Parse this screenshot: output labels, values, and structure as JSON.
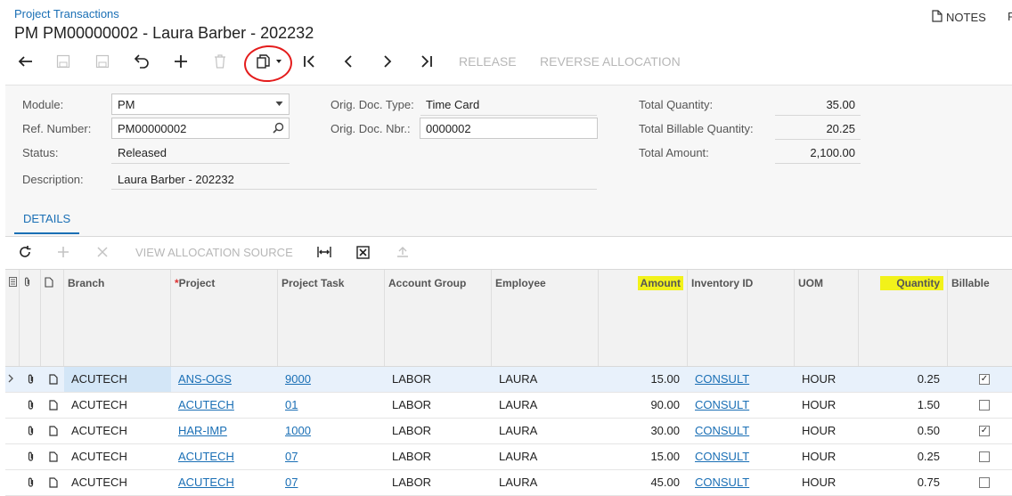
{
  "header": {
    "breadcrumb": "Project Transactions",
    "title": "PM PM00000002 - Laura Barber - 202232",
    "notes_label": "NOTES",
    "cutoff_letter": "F"
  },
  "toolbar": {
    "icons": [
      "back-icon",
      "save-close-icon",
      "save-icon",
      "undo-icon",
      "add-icon",
      "delete-icon",
      "copy-paste-icon",
      "first-record-icon",
      "prev-record-icon",
      "next-record-icon",
      "last-record-icon"
    ],
    "release_label": "RELEASE",
    "reverse_allocation_label": "REVERSE ALLOCATION"
  },
  "form": {
    "module_label": "Module:",
    "module_value": "PM",
    "ref_label": "Ref. Number:",
    "ref_value": "PM00000002",
    "status_label": "Status:",
    "status_value": "Released",
    "description_label": "Description:",
    "description_value": "Laura Barber - 202232",
    "orig_type_label": "Orig. Doc. Type:",
    "orig_type_value": "Time Card",
    "orig_nbr_label": "Orig. Doc. Nbr.:",
    "orig_nbr_value": "0000002",
    "total_qty_label": "Total Quantity:",
    "total_qty_value": "35.00",
    "total_billable_label": "Total Billable Quantity:",
    "total_billable_value": "20.25",
    "total_amount_label": "Total Amount:",
    "total_amount_value": "2,100.00"
  },
  "tabs": {
    "details": "DETAILS"
  },
  "grid_toolbar": {
    "view_allocation_label": "VIEW ALLOCATION SOURCE"
  },
  "columns": {
    "branch": "Branch",
    "project_required": "*",
    "project": "Project",
    "project_task": "Project Task",
    "account_group": "Account Group",
    "employee": "Employee",
    "amount": "Amount",
    "inventory_id": "Inventory ID",
    "uom": "UOM",
    "quantity": "Quantity",
    "billable": "Billable"
  },
  "rows": [
    {
      "branch": "ACUTECH",
      "project": "ANS-OGS",
      "task": "9000",
      "account_group": "LABOR",
      "employee": "LAURA",
      "amount": "15.00",
      "inventory": "CONSULT",
      "uom": "HOUR",
      "quantity": "0.25",
      "billable": "✓"
    },
    {
      "branch": "ACUTECH",
      "project": "ACUTECH",
      "task": "01",
      "account_group": "LABOR",
      "employee": "LAURA",
      "amount": "90.00",
      "inventory": "CONSULT",
      "uom": "HOUR",
      "quantity": "1.50",
      "billable": ""
    },
    {
      "branch": "ACUTECH",
      "project": "HAR-IMP",
      "task": "1000",
      "account_group": "LABOR",
      "employee": "LAURA",
      "amount": "30.00",
      "inventory": "CONSULT",
      "uom": "HOUR",
      "quantity": "0.50",
      "billable": "✓"
    },
    {
      "branch": "ACUTECH",
      "project": "ACUTECH",
      "task": "07",
      "account_group": "LABOR",
      "employee": "LAURA",
      "amount": "15.00",
      "inventory": "CONSULT",
      "uom": "HOUR",
      "quantity": "0.25",
      "billable": ""
    },
    {
      "branch": "ACUTECH",
      "project": "ACUTECH",
      "task": "07",
      "account_group": "LABOR",
      "employee": "LAURA",
      "amount": "45.00",
      "inventory": "CONSULT",
      "uom": "HOUR",
      "quantity": "0.75",
      "billable": ""
    }
  ],
  "colors": {
    "accent": "#1a6fb5",
    "highlight": "#f2f21a",
    "annotation": "#e41c1c"
  }
}
